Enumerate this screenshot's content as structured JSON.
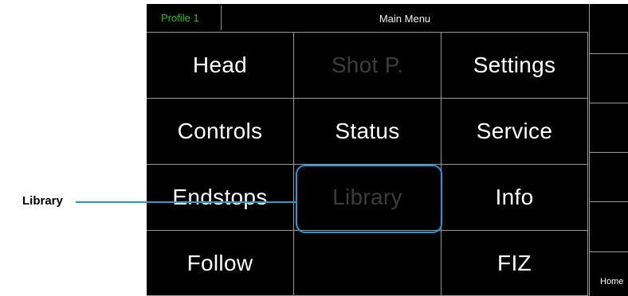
{
  "header": {
    "profile_label": "Profile 1",
    "menu_title": "Main Menu"
  },
  "grid": [
    {
      "label": "Head",
      "enabled": true
    },
    {
      "label": "Shot P.",
      "enabled": false
    },
    {
      "label": "Settings",
      "enabled": true
    },
    {
      "label": "Controls",
      "enabled": true
    },
    {
      "label": "Status",
      "enabled": true
    },
    {
      "label": "Service",
      "enabled": true
    },
    {
      "label": "Endstops",
      "enabled": true
    },
    {
      "label": "Library",
      "enabled": false
    },
    {
      "label": "Info",
      "enabled": true
    },
    {
      "label": "Follow",
      "enabled": true
    },
    {
      "label": "",
      "enabled": true
    },
    {
      "label": "FIZ",
      "enabled": true
    }
  ],
  "side_buttons": [
    "",
    "",
    "",
    "",
    "",
    "Home"
  ],
  "callout": {
    "label": "Library",
    "color": "#1e9be0"
  },
  "colors": {
    "profile_text": "#22c026",
    "disabled_text": "#3c3c3c",
    "background": "#000000"
  }
}
